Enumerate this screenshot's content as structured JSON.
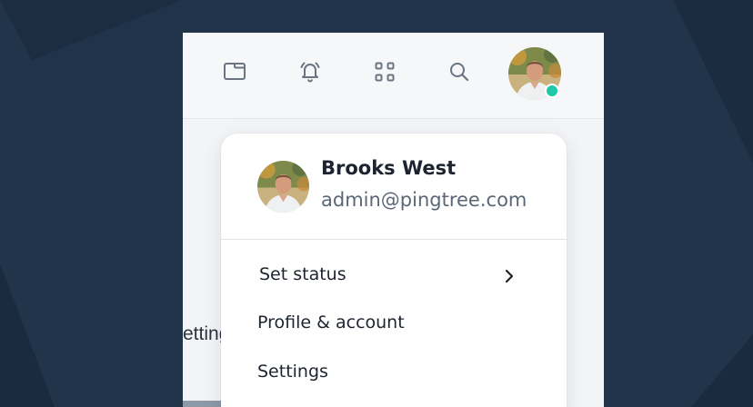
{
  "toolbar": {
    "icons": [
      "window-icon",
      "bell-icon",
      "apps-grid-icon",
      "search-icon"
    ],
    "user_status": "online",
    "status_color": "#1fc9a8"
  },
  "page": {
    "peek_text": "Setting"
  },
  "profile": {
    "name": "Brooks West",
    "email": "admin@pingtree.com"
  },
  "menu": {
    "items": [
      {
        "label": "Set status",
        "has_submenu": true
      },
      {
        "label": "Profile & account",
        "has_submenu": false
      },
      {
        "label": "Settings",
        "has_submenu": false
      }
    ]
  },
  "colors": {
    "background": "#22344a",
    "panel": "#f3f4f6",
    "text": "#1d2430",
    "muted_text": "#5b6777"
  }
}
